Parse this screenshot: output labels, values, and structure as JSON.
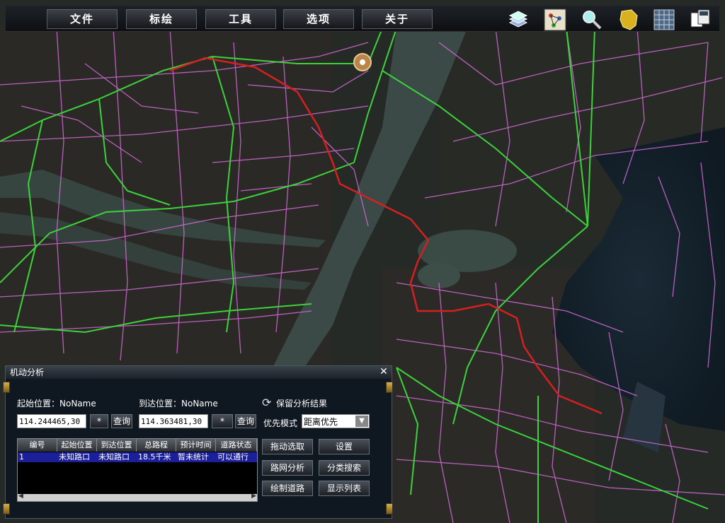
{
  "menu": [
    "文件",
    "标绘",
    "工具",
    "选项",
    "关于"
  ],
  "toolbar_icons": [
    "layers-icon",
    "network-icon",
    "magnifier-icon",
    "gold-map-icon",
    "grid-icon",
    "windows-icon"
  ],
  "panel": {
    "title": "机动分析",
    "start_label": "起始位置：NoName",
    "end_label": "到达位置：NoName",
    "start_value": "114.244465,30",
    "end_value": "114.363481,30",
    "star": "*",
    "query": "查询",
    "keep_result": "保留分析结果",
    "priority_label": "优先模式",
    "priority_value": "距离优先",
    "buttons": {
      "drag_select": "拖动选取",
      "settings": "设置",
      "network_analysis": "路网分析",
      "category_search": "分类搜索",
      "draw_road": "绘制道路",
      "show_list": "显示列表"
    },
    "table": {
      "headers": [
        "编号",
        "起始位置",
        "到达位置",
        "总路程",
        "预计时间",
        "道路状态"
      ],
      "row": [
        "1",
        "未知路口",
        "未知路口",
        "18.5千米",
        "暂未统计",
        "可以通行"
      ]
    }
  },
  "colors": {
    "route": "#d62020",
    "road_major": "#3cd23c",
    "road_minor": "#d46ad8"
  }
}
